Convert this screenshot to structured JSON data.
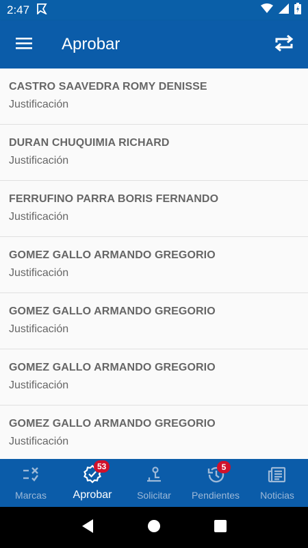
{
  "status_bar": {
    "time": "2:47"
  },
  "app_bar": {
    "title": "Aprobar"
  },
  "list": [
    {
      "name": "CASTRO SAAVEDRA ROMY DENISSE",
      "type": "Justificación"
    },
    {
      "name": "DURAN CHUQUIMIA RICHARD",
      "type": "Justificación"
    },
    {
      "name": "FERRUFINO PARRA BORIS FERNANDO",
      "type": "Justificación"
    },
    {
      "name": "GOMEZ GALLO ARMANDO GREGORIO",
      "type": "Justificación"
    },
    {
      "name": "GOMEZ GALLO ARMANDO GREGORIO",
      "type": "Justificación"
    },
    {
      "name": "GOMEZ GALLO ARMANDO GREGORIO",
      "type": "Justificación"
    },
    {
      "name": "GOMEZ GALLO ARMANDO GREGORIO",
      "type": "Justificación"
    }
  ],
  "bottom_nav": {
    "marcas": {
      "label": "Marcas",
      "icon": "marks-icon"
    },
    "aprobar": {
      "label": "Aprobar",
      "icon": "verified-icon",
      "badge": "53"
    },
    "solicitar": {
      "label": "Solicitar",
      "icon": "request-icon"
    },
    "pendientes": {
      "label": "Pendientes",
      "icon": "history-icon",
      "badge": "5"
    },
    "noticias": {
      "label": "Noticias",
      "icon": "news-icon"
    }
  },
  "colors": {
    "primary": "#0b5ca9",
    "badge": "#d0112b",
    "text": "#666666",
    "inactive": "#9db9d8"
  }
}
